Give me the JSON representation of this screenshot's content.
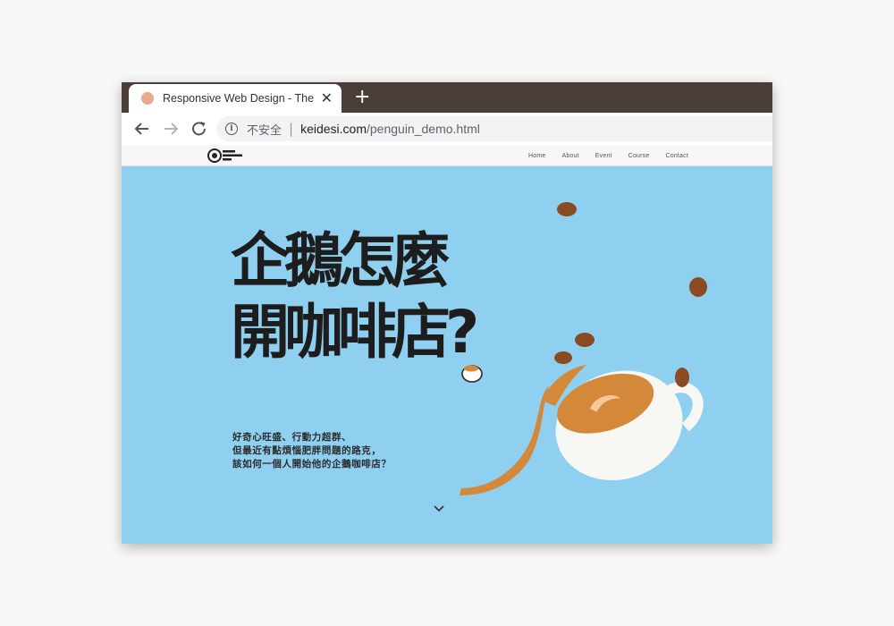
{
  "browser": {
    "tab": {
      "title": "Responsive Web Design - The Penguin Cafe"
    },
    "address": {
      "security_label": "不安全",
      "separator": "|",
      "domain": "keidesi.com",
      "path": "/penguin_demo.html"
    }
  },
  "site": {
    "nav": {
      "home": "Home",
      "about": "About",
      "event": "Event",
      "course": "Course",
      "contact": "Contact"
    },
    "hero": {
      "title_line1": "企鵝怎麼",
      "title_line2": "開咖啡店?",
      "lines": [
        "好奇心旺盛、行動力超群、",
        "但最近有點煩惱肥胖問題的路克，",
        "該如何一個人開始他的企鵝咖啡店？"
      ]
    }
  },
  "colors": {
    "tabbar": "#4b3e38",
    "hero_bg": "#8fd0f0",
    "coffee": "#d4893a",
    "bean": "#8a4b22",
    "cup": "#f7f7f4"
  },
  "icons": [
    "back-icon",
    "forward-icon",
    "reload-icon",
    "info-icon",
    "close-icon",
    "plus-icon",
    "chevron-down-icon",
    "coffee-bean-icon",
    "coffee-cup-icon"
  ]
}
